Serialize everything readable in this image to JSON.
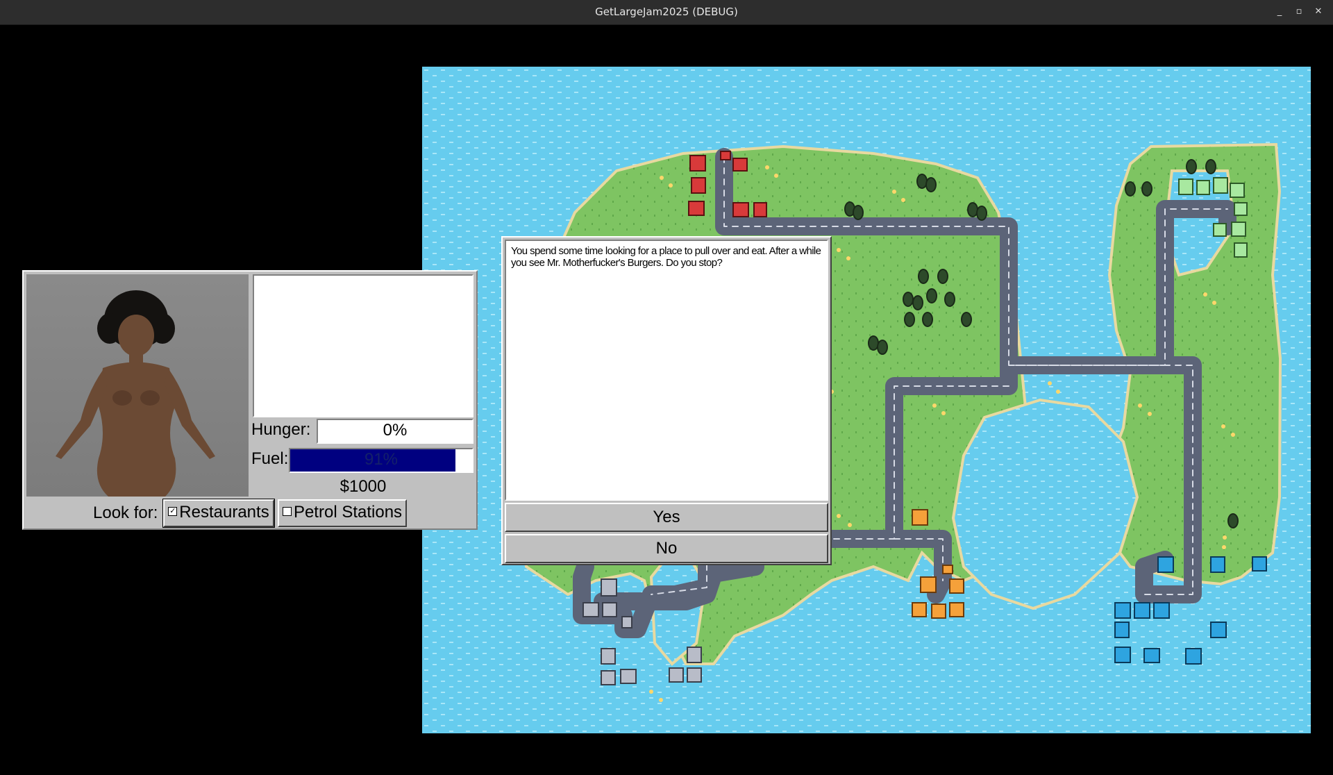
{
  "window": {
    "title": "GetLargeJam2025 (DEBUG)",
    "controls": {
      "minimize": "_",
      "maximize": "▫",
      "close": "✕"
    }
  },
  "status": {
    "hunger_label": "Hunger:",
    "hunger_value": "0%",
    "hunger_fraction": 0.0,
    "fuel_label": "Fuel:",
    "fuel_value": "91%",
    "fuel_fraction": 0.91,
    "money": "$1000",
    "look_for_label": "Look for:",
    "restaurants_label": "Restaurants",
    "restaurants_checked": true,
    "petrol_label": "Petrol Stations",
    "petrol_checked": false
  },
  "dialog": {
    "text": "You spend some time looking for a place to pull over and eat.  After a while you see Mr. Motherfucker's Burgers.  Do you stop?",
    "yes_label": "Yes",
    "no_label": "No"
  },
  "colors": {
    "water": "#66ccee",
    "grass": "#7ec462",
    "road": "#5c6478",
    "fuel_bar": "#000080",
    "panel": "#c0c0c0"
  }
}
